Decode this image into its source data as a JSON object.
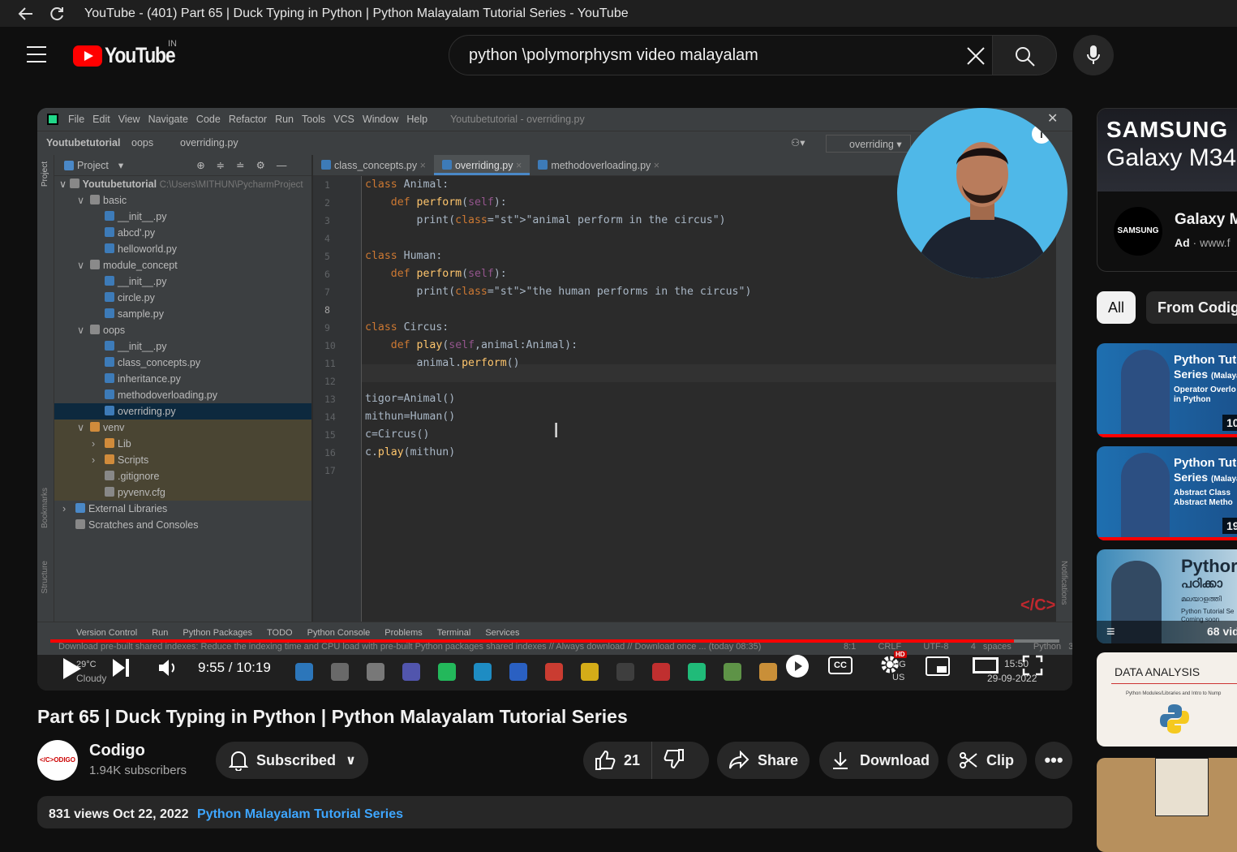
{
  "window": {
    "title": "YouTube - (401) Part 65 | Duck Typing in Python | Python Malayalam Tutorial Series - YouTube"
  },
  "header": {
    "logo_text": "YouTube",
    "region": "IN",
    "search_value": "python \\polymorphysm video malayalam"
  },
  "ide": {
    "menu": [
      "File",
      "Edit",
      "View",
      "Navigate",
      "Code",
      "Refactor",
      "Run",
      "Tools",
      "VCS",
      "Window",
      "Help"
    ],
    "window_title": "Youtubetutorial - overriding.py",
    "breadcrumb": [
      "Youtubetutorial",
      "oops",
      "overriding.py"
    ],
    "run_config": "overriding",
    "project_label": "Project",
    "root_name": "Youtubetutorial",
    "root_path": "C:\\Users\\MITHUN\\PycharmProject",
    "tree": [
      {
        "label": "basic",
        "indent": 1,
        "type": "folder",
        "open": true
      },
      {
        "label": "__init__.py",
        "indent": 2,
        "type": "py"
      },
      {
        "label": "abcd'.py",
        "indent": 2,
        "type": "py"
      },
      {
        "label": "helloworld.py",
        "indent": 2,
        "type": "py"
      },
      {
        "label": "module_concept",
        "indent": 1,
        "type": "folder",
        "open": true
      },
      {
        "label": "__init__.py",
        "indent": 2,
        "type": "py"
      },
      {
        "label": "circle.py",
        "indent": 2,
        "type": "py"
      },
      {
        "label": "sample.py",
        "indent": 2,
        "type": "py"
      },
      {
        "label": "oops",
        "indent": 1,
        "type": "folder",
        "open": true
      },
      {
        "label": "__init__.py",
        "indent": 2,
        "type": "py"
      },
      {
        "label": "class_concepts.py",
        "indent": 2,
        "type": "py"
      },
      {
        "label": "inheritance.py",
        "indent": 2,
        "type": "py"
      },
      {
        "label": "methodoverloading.py",
        "indent": 2,
        "type": "py"
      },
      {
        "label": "overriding.py",
        "indent": 2,
        "type": "py",
        "selected": true
      },
      {
        "label": "venv",
        "indent": 1,
        "type": "venv",
        "open": true
      },
      {
        "label": "Lib",
        "indent": 2,
        "type": "venvfolder",
        "collapsed": true
      },
      {
        "label": "Scripts",
        "indent": 2,
        "type": "venvfolder",
        "collapsed": true
      },
      {
        "label": ".gitignore",
        "indent": 2,
        "type": "file"
      },
      {
        "label": "pyvenv.cfg",
        "indent": 2,
        "type": "file"
      },
      {
        "label": "External Libraries",
        "indent": 0,
        "type": "lib",
        "collapsed": true
      },
      {
        "label": "Scratches and Consoles",
        "indent": 0,
        "type": "scratch"
      }
    ],
    "tabs": [
      "class_concepts.py",
      "overriding.py",
      "methodoverloading.py"
    ],
    "active_tab": 1,
    "line_numbers": [
      "1",
      "2",
      "3",
      "4",
      "5",
      "6",
      "7",
      "8",
      "9",
      "10",
      "11",
      "12",
      "13",
      "14",
      "15",
      "16",
      "17"
    ],
    "code": [
      "class Animal:",
      "    def perform(self):",
      "        print(\"animal perform in the circus\")",
      "",
      "class Human:",
      "    def perform(self):",
      "        print(\"the human performs in the circus\")",
      "",
      "class Circus:",
      "    def play(self,animal:Animal):",
      "        animal.perform()",
      "",
      "tigor=Animal()",
      "mithun=Human()",
      "c=Circus()",
      "c.play(mithun)",
      ""
    ],
    "toolwindows": [
      "Version Control",
      "Run",
      "Python Packages",
      "TODO",
      "Python Console",
      "Problems",
      "Terminal",
      "Services"
    ],
    "status": "Download pre-built shared indexes: Reduce the indexing time and CPU load with pre-built Python packages shared indexes // Always download // Download once ... (today 08:35)",
    "status_right": [
      "8:1",
      "CRLF",
      "UTF-8",
      "4 spaces",
      "Python 3.10 (4)"
    ],
    "side_labels": [
      "Project",
      "Bookmarks",
      "Structure",
      "Notifications"
    ]
  },
  "player": {
    "time": "9:55 / 10:19",
    "progress": 0.955,
    "weather_temp": "29°C",
    "weather_label": "Cloudy",
    "clock_time": "15:50",
    "clock_date": "29-09-2022",
    "lang": "ENG",
    "lang2": "US",
    "hd_badge": "HD",
    "brand_tag": "</C>"
  },
  "video": {
    "title": "Part 65 | Duck Typing in Python | Python Malayalam Tutorial Series",
    "channel": "Codigo",
    "channel_avatar_text": "</C>ODIGO",
    "subscribers": "1.94K subscribers",
    "subscribe_label": "Subscribed",
    "likes": "21",
    "share_label": "Share",
    "download_label": "Download",
    "clip_label": "Clip",
    "views_date": "831 views  Oct 22, 2022",
    "playlist_link": "Python Malayalam Tutorial Series"
  },
  "sidebar": {
    "ad": {
      "brand": "SAMSUNG",
      "product": "Galaxy M34",
      "title": "Galaxy M",
      "ad_label": "Ad",
      "url": "www.f",
      "logo_text": "SAMSUNG"
    },
    "chips": [
      "All",
      "From Codigo"
    ],
    "thumbs": [
      {
        "line1": "Python Tuto",
        "line2": "Series",
        "small": "(Malaya",
        "sub1": "Operator Overlo",
        "sub2": "in Python",
        "badge": "10"
      },
      {
        "line1": "Python Tuto",
        "line2": "Series",
        "small": "(Malaya",
        "sub1": "Abstract Class",
        "sub2": "Abstract Metho",
        "badge": "19"
      },
      {
        "line1": "Pythor",
        "line2": "പഠിക്കാ",
        "small": "മലയാളത്തി",
        "sub1": "Python Tutorial Se",
        "sub2": "Coming soon",
        "badge": "68 vid"
      },
      {
        "line1": "DATA ANALYSIS",
        "line2": "",
        "small": "",
        "sub1": "Python Modules/Libraries and Intro to Nump",
        "sub2": "",
        "badge": ""
      }
    ]
  }
}
